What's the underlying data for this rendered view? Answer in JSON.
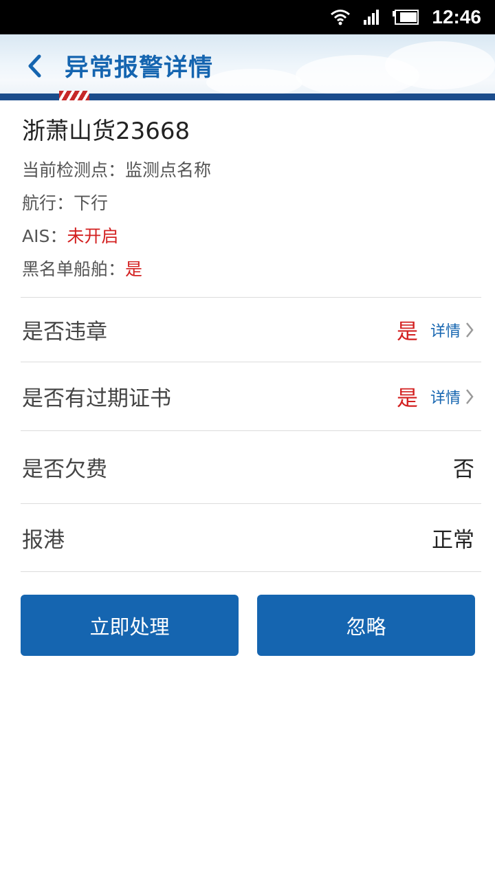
{
  "status_bar": {
    "time": "12:46"
  },
  "header": {
    "title": "异常报警详情"
  },
  "ship": {
    "name": "浙萧山货23668",
    "checkpoint_label": "当前检测点：",
    "checkpoint_value": "监测点名称",
    "direction_label": "航行：",
    "direction_value": "下行",
    "ais_label": "AIS：",
    "ais_value": "未开启",
    "blacklist_label": "黑名单船舶：",
    "blacklist_value": "是"
  },
  "rows": [
    {
      "label": "是否违章",
      "value": "是",
      "detail": "详情"
    },
    {
      "label": "是否有过期证书",
      "value": "是",
      "detail": "详情"
    },
    {
      "label": "是否欠费",
      "value": "否"
    },
    {
      "label": "报港",
      "value": "正常"
    }
  ],
  "actions": {
    "process": "立即处理",
    "ignore": "忽略"
  },
  "colors": {
    "accent": "#1565b0",
    "alert": "#d32020"
  }
}
